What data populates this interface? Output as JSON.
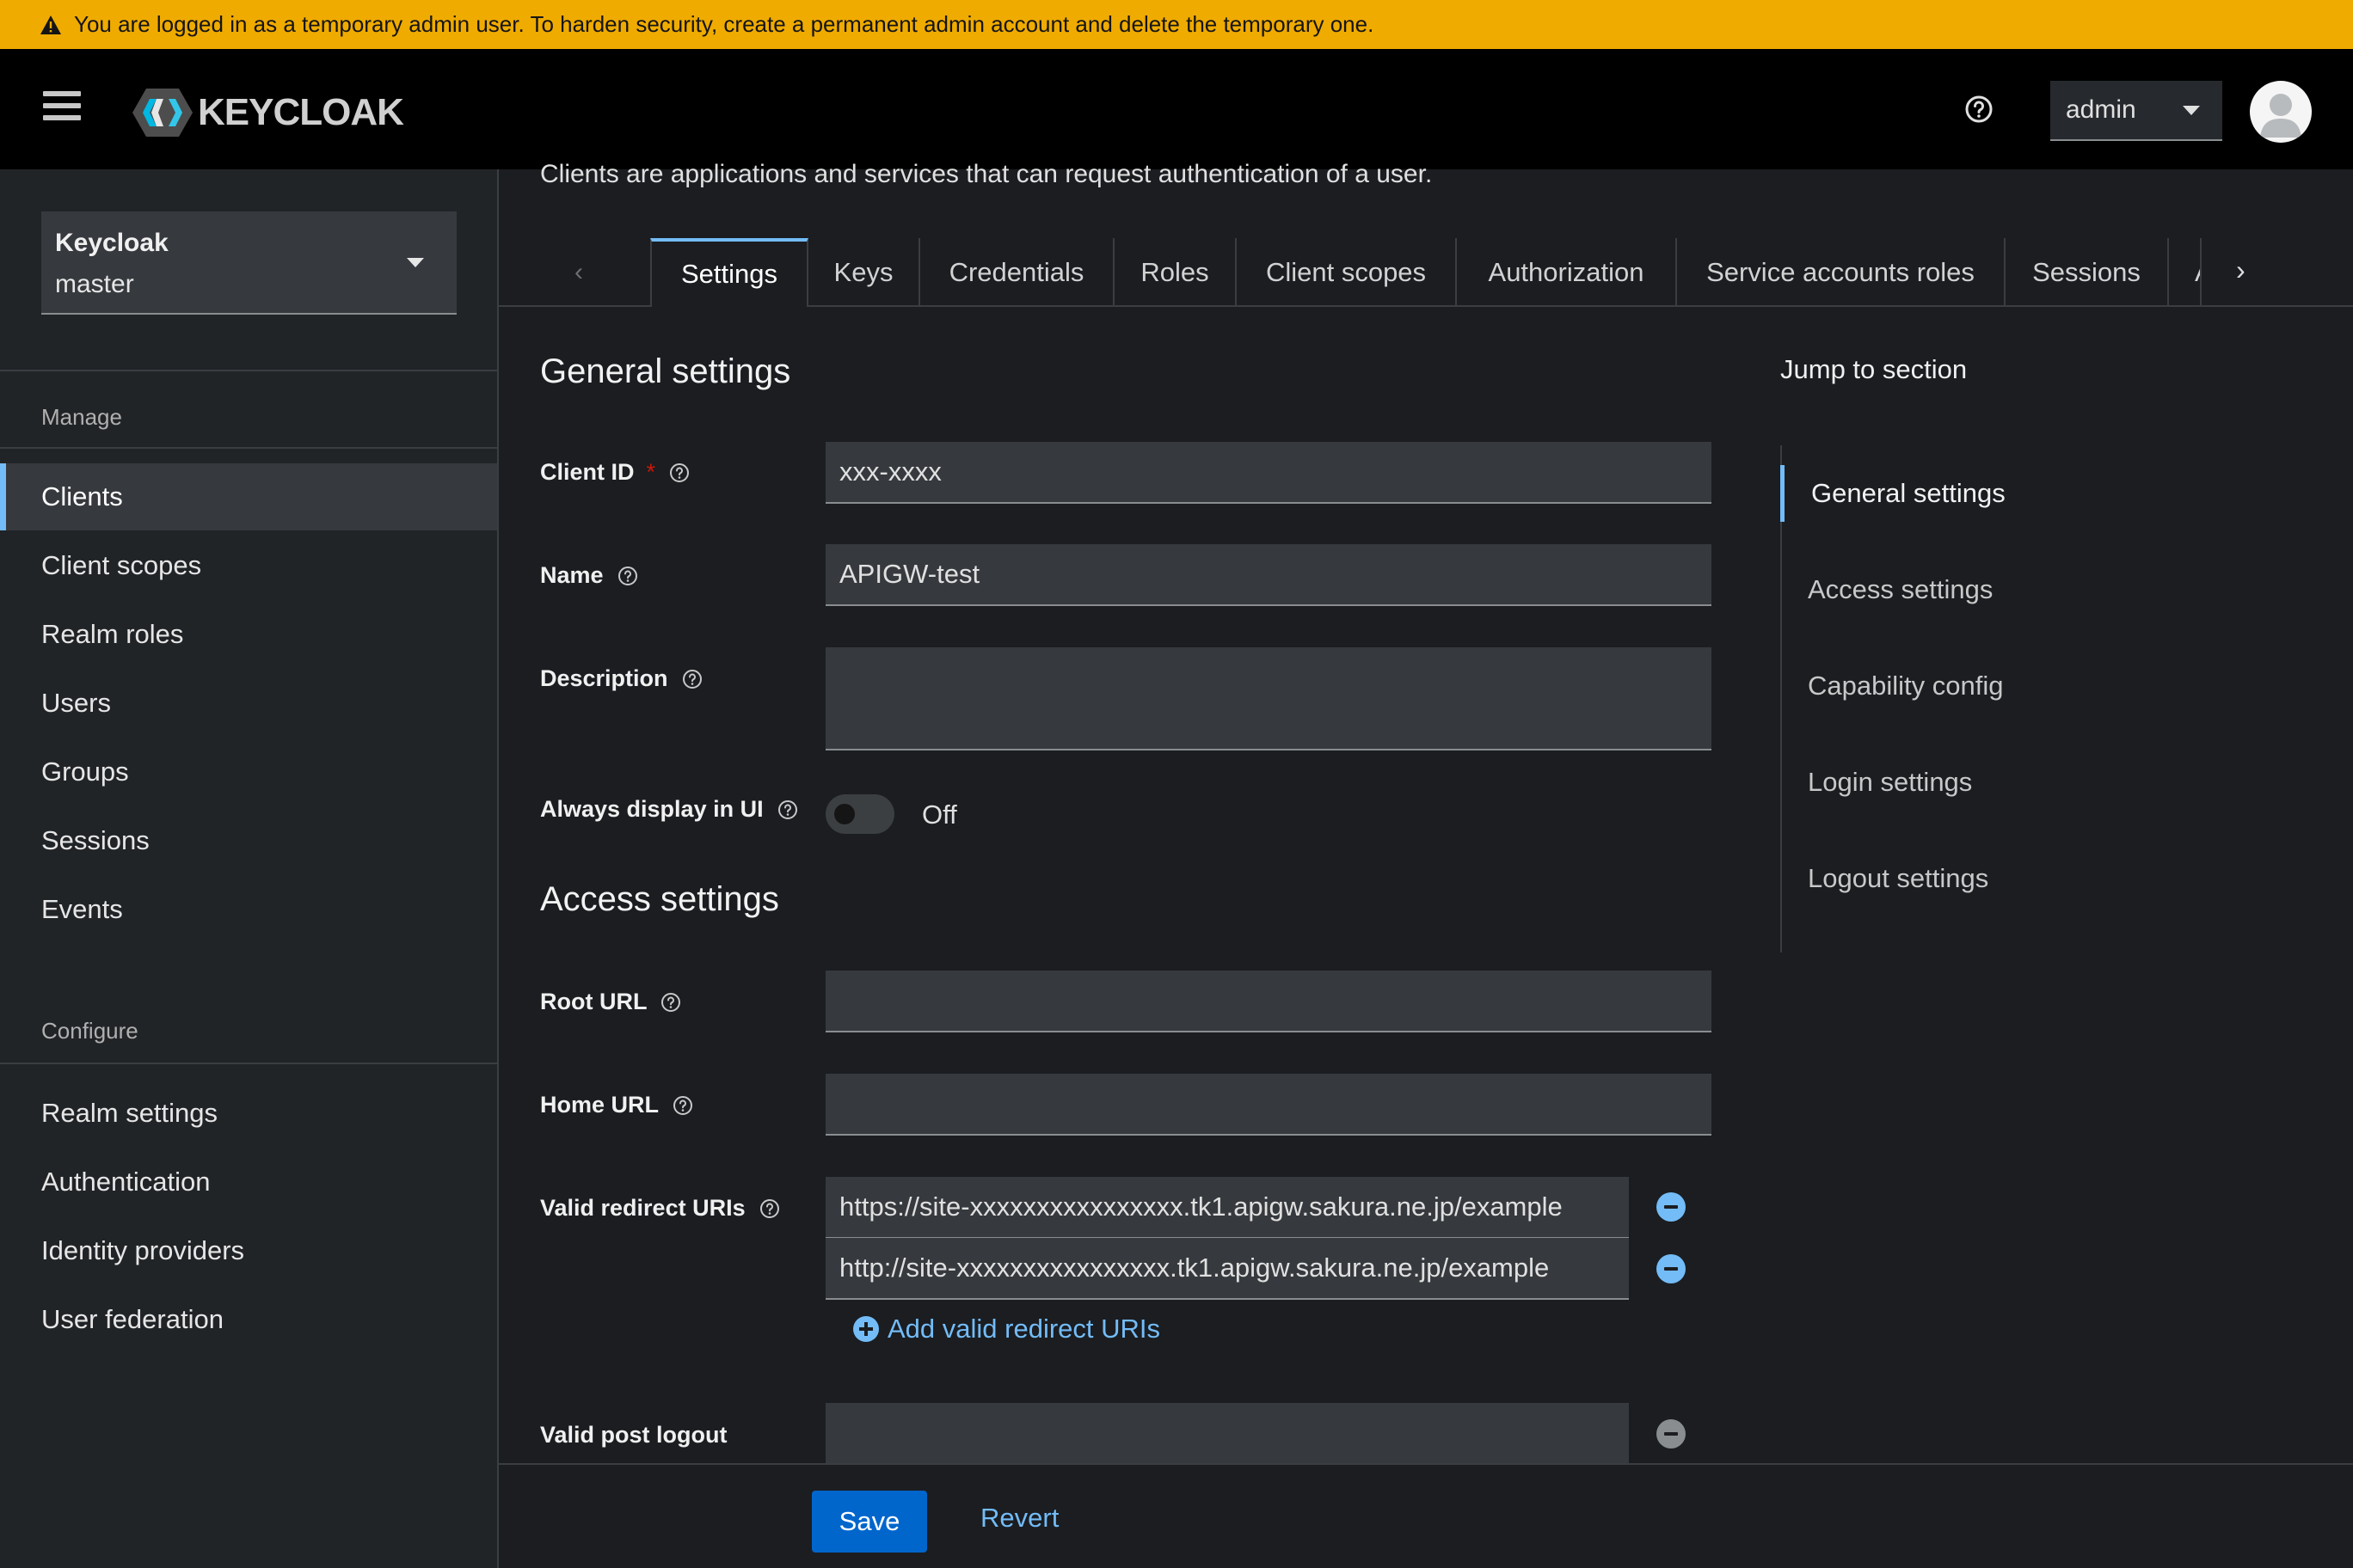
{
  "banner": {
    "text": "You are logged in as a temporary admin user. To harden security, create a permanent admin account and delete the temporary one."
  },
  "header": {
    "logo_text": "KEYCLOAK",
    "user_label": "admin"
  },
  "realm": {
    "name": "Keycloak",
    "id": "master"
  },
  "sidebar": {
    "manage_label": "Manage",
    "manage_items": [
      {
        "label": "Clients",
        "active": true
      },
      {
        "label": "Client scopes"
      },
      {
        "label": "Realm roles"
      },
      {
        "label": "Users"
      },
      {
        "label": "Groups"
      },
      {
        "label": "Sessions"
      },
      {
        "label": "Events"
      }
    ],
    "configure_label": "Configure",
    "configure_items": [
      {
        "label": "Realm settings"
      },
      {
        "label": "Authentication"
      },
      {
        "label": "Identity providers"
      },
      {
        "label": "User federation"
      }
    ]
  },
  "page": {
    "description": "Clients are applications and services that can request authentication of a user."
  },
  "tabs": [
    "Settings",
    "Keys",
    "Credentials",
    "Roles",
    "Client scopes",
    "Authorization",
    "Service accounts roles",
    "Sessions",
    "A"
  ],
  "general": {
    "title": "General settings",
    "client_id_label": "Client ID",
    "client_id_required": "*",
    "client_id_value": "xxx-xxxx",
    "name_label": "Name",
    "name_value": "APIGW-test",
    "description_label": "Description",
    "description_value": "",
    "always_display_label": "Always display in UI",
    "always_display_state": "Off"
  },
  "access": {
    "title": "Access settings",
    "root_url_label": "Root URL",
    "root_url_value": "",
    "home_url_label": "Home URL",
    "home_url_value": "",
    "redirect_label": "Valid redirect URIs",
    "redirect_uris": [
      "https://site-xxxxxxxxxxxxxxxx.tk1.apigw.sakura.ne.jp/example",
      "http://site-xxxxxxxxxxxxxxxx.tk1.apigw.sakura.ne.jp/example"
    ],
    "add_redirect_label": "Add valid redirect URIs",
    "post_logout_label": "Valid post logout",
    "post_logout_value": ""
  },
  "jump": {
    "title": "Jump to section",
    "items": [
      "General settings",
      "Access settings",
      "Capability config",
      "Login settings",
      "Logout settings"
    ]
  },
  "footer": {
    "save_label": "Save",
    "revert_label": "Revert"
  },
  "colors": {
    "banner": "#f0ab00",
    "accent": "#73bcf7",
    "primary": "#0066cc",
    "danger": "#c9190b"
  }
}
